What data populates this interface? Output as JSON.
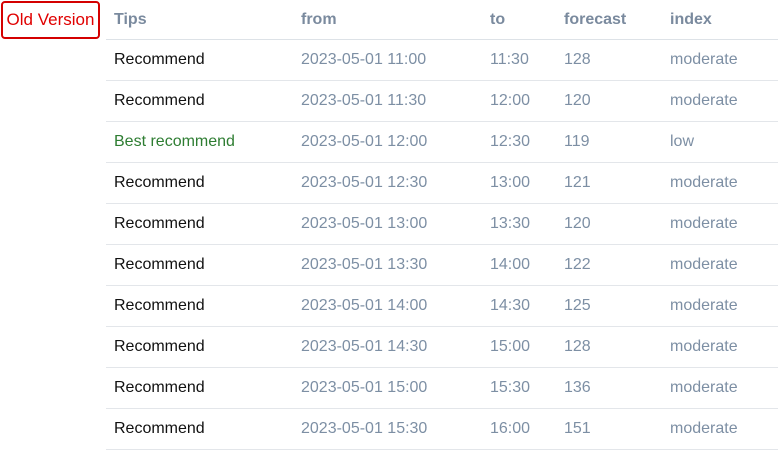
{
  "badge": {
    "label": "Old Version",
    "color": "#e00000"
  },
  "table": {
    "headers": {
      "tips": "Tips",
      "from": "from",
      "to": "to",
      "forecast": "forecast",
      "index": "index"
    },
    "rows": [
      {
        "tips": "Recommend",
        "from": "2023-05-01 11:00",
        "to": "11:30",
        "forecast": "128",
        "index": "moderate",
        "best": false
      },
      {
        "tips": "Recommend",
        "from": "2023-05-01 11:30",
        "to": "12:00",
        "forecast": "120",
        "index": "moderate",
        "best": false
      },
      {
        "tips": "Best recommend",
        "from": "2023-05-01 12:00",
        "to": "12:30",
        "forecast": "119",
        "index": "low",
        "best": true
      },
      {
        "tips": "Recommend",
        "from": "2023-05-01 12:30",
        "to": "13:00",
        "forecast": "121",
        "index": "moderate",
        "best": false
      },
      {
        "tips": "Recommend",
        "from": "2023-05-01 13:00",
        "to": "13:30",
        "forecast": "120",
        "index": "moderate",
        "best": false
      },
      {
        "tips": "Recommend",
        "from": "2023-05-01 13:30",
        "to": "14:00",
        "forecast": "122",
        "index": "moderate",
        "best": false
      },
      {
        "tips": "Recommend",
        "from": "2023-05-01 14:00",
        "to": "14:30",
        "forecast": "125",
        "index": "moderate",
        "best": false
      },
      {
        "tips": "Recommend",
        "from": "2023-05-01 14:30",
        "to": "15:00",
        "forecast": "128",
        "index": "moderate",
        "best": false
      },
      {
        "tips": "Recommend",
        "from": "2023-05-01 15:00",
        "to": "15:30",
        "forecast": "136",
        "index": "moderate",
        "best": false
      },
      {
        "tips": "Recommend",
        "from": "2023-05-01 15:30",
        "to": "16:00",
        "forecast": "151",
        "index": "moderate",
        "best": false
      }
    ]
  },
  "colors": {
    "best_recommend": "#2e7d32",
    "header_text": "#7a8a9e",
    "cell_text": "#7d8fa4"
  }
}
